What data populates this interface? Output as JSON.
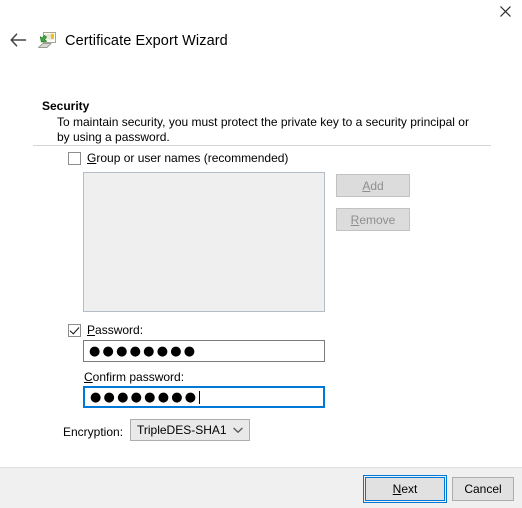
{
  "window": {
    "close_icon": "close-icon",
    "back_icon": "back-arrow-icon",
    "app_icon": "certificate-export-icon",
    "title": "Certificate Export Wizard"
  },
  "page": {
    "heading": "Security",
    "description": "To maintain security, you must protect the private key to a security principal or by using a password."
  },
  "group_names": {
    "label_accel": "G",
    "label_rest": "roup or user names (recommended)",
    "checked": false,
    "list_items": []
  },
  "side_buttons": {
    "add": {
      "accel": "A",
      "rest": "dd",
      "enabled": false
    },
    "remove": {
      "accel": "R",
      "rest": "emove",
      "enabled": false
    }
  },
  "password": {
    "label_accel": "P",
    "label_rest": "assword:",
    "checked": true,
    "value_masked": "●●●●●●●●",
    "char_count": 8
  },
  "confirm_password": {
    "label_accel": "C",
    "label_rest": "onfirm password:",
    "value_masked": "●●●●●●●●",
    "char_count": 8,
    "focused": true
  },
  "encryption": {
    "label": "Encryption:",
    "selected": "TripleDES-SHA1",
    "arrow_icon": "chevron-down-icon"
  },
  "footer": {
    "next_accel": "N",
    "next_rest": "ext",
    "cancel": "Cancel"
  },
  "colors": {
    "accent": "#0078d7",
    "footer_bg": "#f0f0f0",
    "disabled_text": "#8e8e8e",
    "listbox_bg": "#efefef"
  }
}
